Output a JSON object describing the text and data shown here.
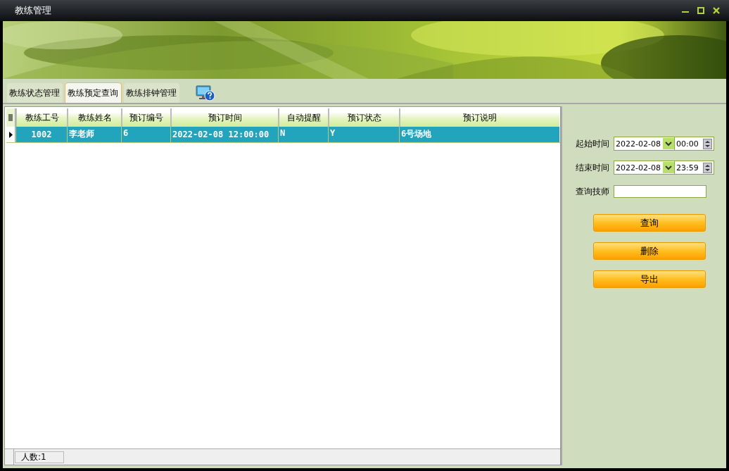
{
  "window": {
    "title": "教练管理"
  },
  "tabs": [
    {
      "label": "教练状态管理",
      "selected": false
    },
    {
      "label": "教练预定查询",
      "selected": true
    },
    {
      "label": "教练排钟管理",
      "selected": false
    }
  ],
  "table": {
    "columns": [
      "教练工号",
      "教练姓名",
      "预订编号",
      "预订时间",
      "自动提醒",
      "预订状态",
      "预订说明"
    ],
    "rows": [
      {
        "selected": true,
        "cells": [
          "1002",
          "李老师",
          "6",
          "2022-02-08  12:00:00",
          "N",
          "Y",
          "6号场地"
        ]
      }
    ]
  },
  "status_bar": {
    "count": "人数:1"
  },
  "filters": [
    {
      "kind": "datetime",
      "label": "起始时间",
      "date": "2022-02-08",
      "time": "00:00"
    },
    {
      "kind": "datetime",
      "label": "结束时间",
      "date": "2022-02-08",
      "time": "23:59"
    },
    {
      "kind": "text",
      "label": "查询技师"
    }
  ],
  "buttons": [
    "查询",
    "删除",
    "导出"
  ]
}
